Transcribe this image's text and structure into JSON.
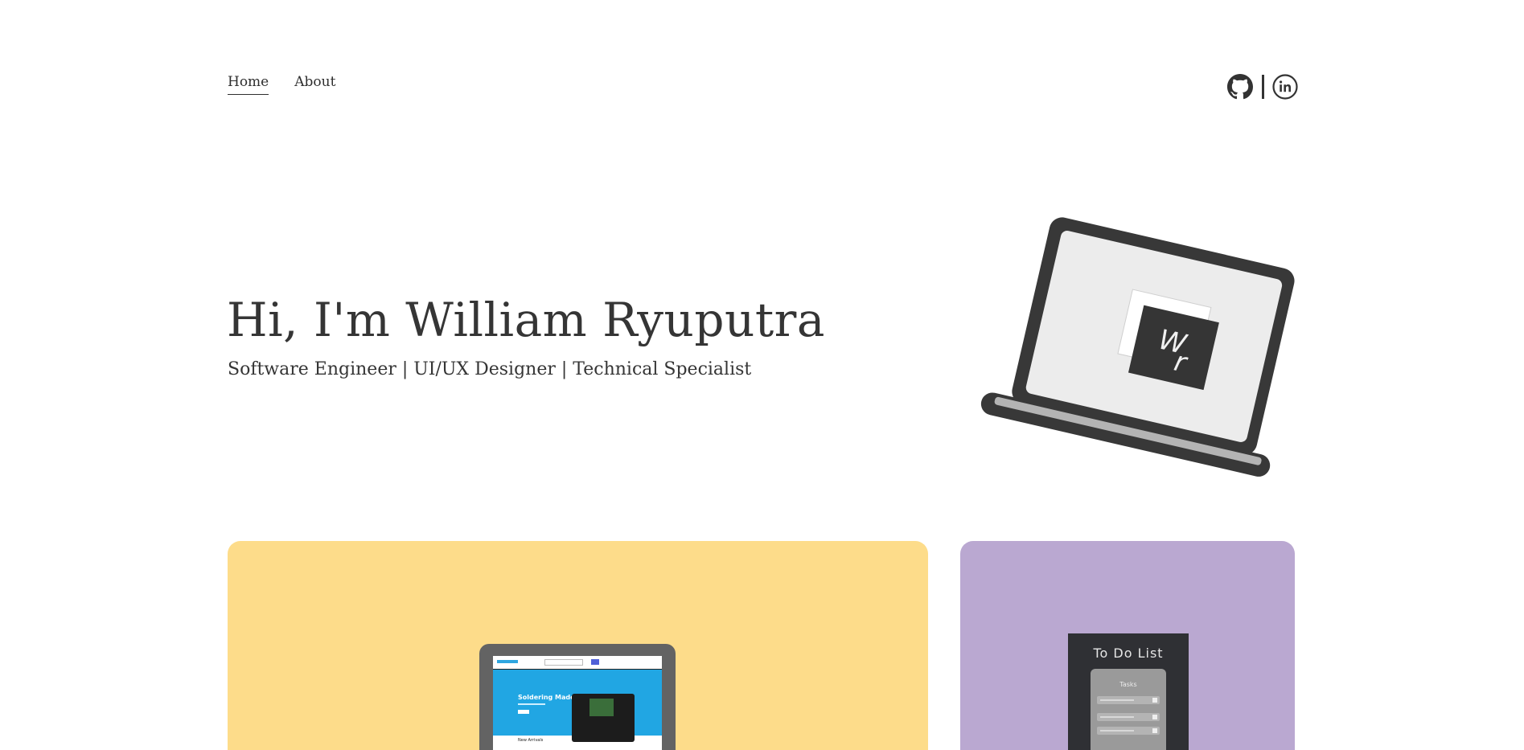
{
  "nav": {
    "home": "Home",
    "about": "About"
  },
  "socials": {
    "github_icon": "github-icon",
    "linkedin_icon": "linkedin-icon"
  },
  "hero": {
    "title": "Hi, I'm William Ryuputra",
    "subtitle": "Software Engineer | UI/UX Designer | Technical Specialist",
    "logo_initials_top": "W",
    "logo_initials_bottom": "r"
  },
  "projects": [
    {
      "card_color": "#fddc8a",
      "preview_headline": "Soldering Made Fun",
      "preview_section": "New Arrivals"
    },
    {
      "card_color": "#baa8d1",
      "preview_title": "To Do List",
      "preview_box_title": "Tasks"
    }
  ],
  "colors": {
    "text": "#353535",
    "accent_yellow": "#fddc8a",
    "accent_purple": "#baa8d1"
  }
}
